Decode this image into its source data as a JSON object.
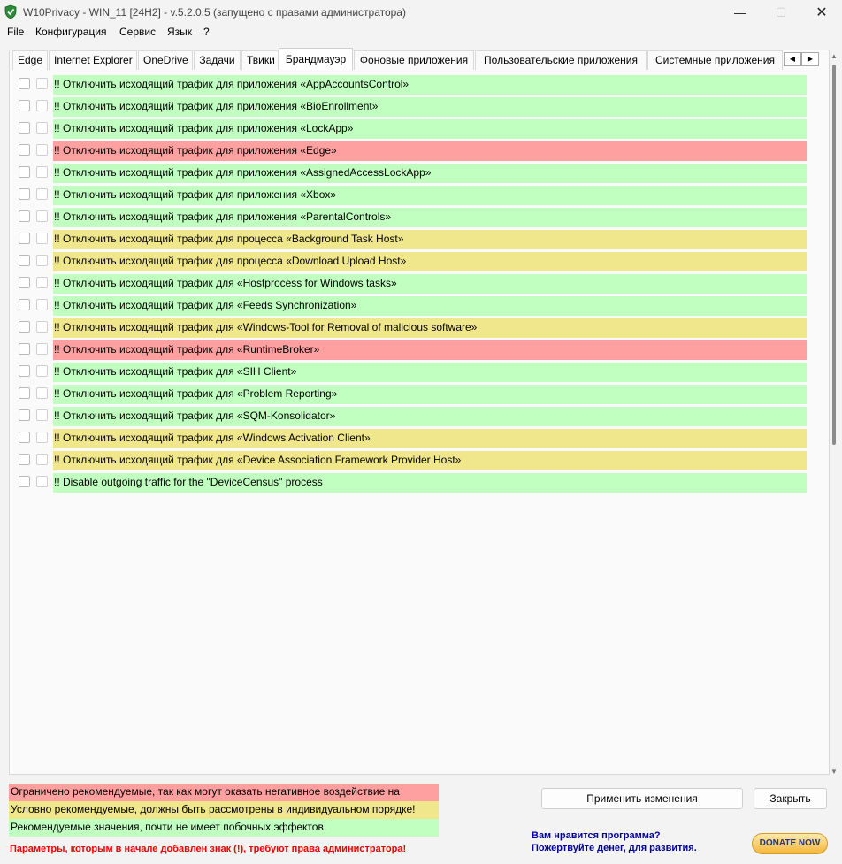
{
  "window": {
    "title": "W10Privacy - WIN_11 [24H2]  - v.5.2.0.5 (запущено с правами администратора)",
    "min_glyph": "—",
    "max_glyph": "☐",
    "close_glyph": "✕"
  },
  "menu": [
    "File",
    "Конфигурация",
    "Сервис",
    "Язык",
    "?"
  ],
  "tabs": [
    {
      "label": "Edge"
    },
    {
      "label": "Internet Explorer"
    },
    {
      "label": "OneDrive"
    },
    {
      "label": "Задачи"
    },
    {
      "label": "Твики"
    },
    {
      "label": "Брандмауэр",
      "active": true
    },
    {
      "label": "Фоновые приложения"
    },
    {
      "label": "Пользовательские приложения"
    },
    {
      "label": "Системные приложения"
    }
  ],
  "tab_scroll": {
    "left": "◀",
    "right": "▶"
  },
  "items": [
    {
      "text": "!! Отключить исходящий трафик для приложения «AppAccountsControl»",
      "color": "green"
    },
    {
      "text": "!! Отключить исходящий трафик для приложения «BioEnrollment»",
      "color": "green"
    },
    {
      "text": "!! Отключить исходящий трафик для приложения «LockApp»",
      "color": "green"
    },
    {
      "text": "!! Отключить исходящий трафик для приложения «Edge»",
      "color": "red"
    },
    {
      "text": "!! Отключить исходящий трафик для приложения «AssignedAccessLockApp»",
      "color": "green"
    },
    {
      "text": "!! Отключить исходящий трафик для приложения «Xbox»",
      "color": "green"
    },
    {
      "text": "!! Отключить исходящий трафик для приложения «ParentalControls»",
      "color": "green"
    },
    {
      "text": "!! Отключить исходящий трафик для процесса «Background Task Host»",
      "color": "yellow"
    },
    {
      "text": "!! Отключить исходящий трафик для процесса «Download Upload Host»",
      "color": "yellow"
    },
    {
      "text": "!! Отключить исходящий трафик для «Hostprocess for Windows tasks»",
      "color": "green"
    },
    {
      "text": "!! Отключить исходящий трафик для «Feeds Synchronization»",
      "color": "green"
    },
    {
      "text": "!! Отключить исходящий трафик для «Windows-Tool for Removal of malicious software»",
      "color": "yellow"
    },
    {
      "text": "!! Отключить исходящий трафик для «RuntimeBroker»",
      "color": "red"
    },
    {
      "text": "!! Отключить исходящий трафик для «SIH Client»",
      "color": "green"
    },
    {
      "text": "!! Отключить исходящий трафик для «Problem Reporting»",
      "color": "green"
    },
    {
      "text": "!! Отключить исходящий трафик для «SQM-Konsolidator»",
      "color": "green"
    },
    {
      "text": "!! Отключить исходящий трафик для «Windows Activation Client»",
      "color": "yellow"
    },
    {
      "text": "!! Отключить исходящий трафик для «Device Association Framework Provider Host»",
      "color": "yellow"
    },
    {
      "text": "!! Disable outgoing traffic for the \"DeviceCensus\" process",
      "color": "green"
    }
  ],
  "legend": {
    "red": "Ограничено рекомендуемые, так как могут оказать негативное воздействие на",
    "yellow": "Условно рекомендуемые, должны быть рассмотрены в индивидуальном порядке!",
    "green": "Рекомендуемые значения, почти не имеет побочных эффектов."
  },
  "admin_note": "Параметры, которым в начале добавлен знак (!), требуют права администратора!",
  "buttons": {
    "apply": "Применить изменения",
    "close": "Закрыть"
  },
  "donate": {
    "line1": "Вам нравится программа?",
    "line2": "Пожертвуйте денег, для развития.",
    "button": "DONATE NOW"
  },
  "colors": {
    "green": "#c0ffc0",
    "yellow": "#f0e68c",
    "red": "#ffa0a0"
  }
}
